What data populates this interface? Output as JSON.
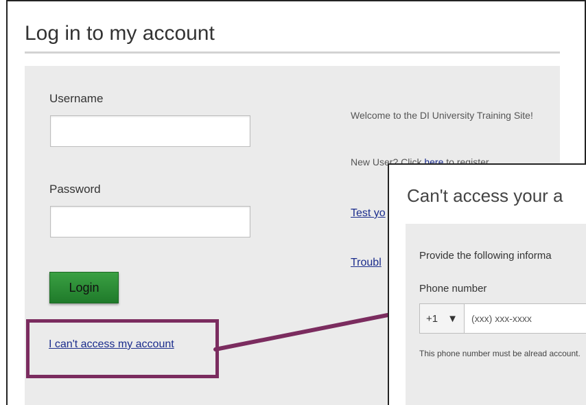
{
  "login": {
    "title": "Log in to my account",
    "username_label": "Username",
    "username_value": "",
    "password_label": "Password",
    "password_value": "",
    "login_button": "Login",
    "cant_access_link": "I can't access my account"
  },
  "side": {
    "welcome": "Welcome to the DI University Training Site!",
    "new_user_prefix": "New User? Click ",
    "here_link": "here",
    "new_user_suffix": " to register",
    "test_link": "Test yo",
    "trouble_link": "Troubl"
  },
  "popup": {
    "title": "Can't access your a",
    "instruction": "Provide the following informa",
    "phone_label": "Phone number",
    "country_code": "+1",
    "phone_placeholder": "(xxx) xxx-xxxx",
    "note": "This phone number must be alread account."
  },
  "colors": {
    "highlight": "#7b2c5f",
    "login_green": "#2e8b37",
    "link_blue": "#1a2c8c",
    "panel_gray": "#ebebeb"
  }
}
